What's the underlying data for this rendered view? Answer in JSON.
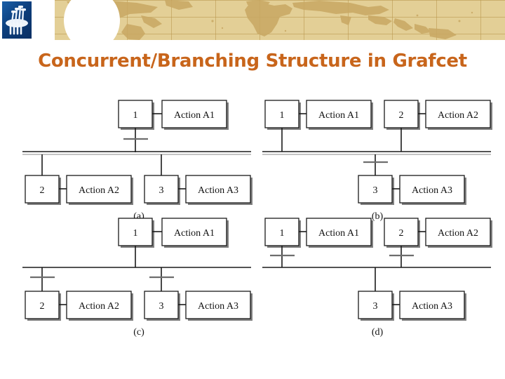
{
  "slide": {
    "title": "Concurrent/Branching Structure in Grafcet",
    "title_color": "#c8651b",
    "banner_color": "#e3cf96",
    "banner_grid_color": "#b7944a",
    "logo_color": "#0d3f7d",
    "background_color": "#ffffff"
  },
  "logo": {
    "name": "institution-logo",
    "description": "abstract white pipes over blue square"
  },
  "figure": {
    "name": "grafcet-branching-figure",
    "line_color": "#1a1a1a",
    "box_fill": "#ffffff",
    "diagrams": [
      {
        "id": "a",
        "caption": "(a)",
        "kind": "simultaneous-divergence",
        "rail": "double",
        "top_steps": [
          {
            "step": "1",
            "action": "Action A1"
          }
        ],
        "bottom_steps": [
          {
            "step": "2",
            "action": "Action A2"
          },
          {
            "step": "3",
            "action": "Action A3"
          }
        ],
        "transitions_above_rail": 1,
        "transitions_below_rail": 0
      },
      {
        "id": "b",
        "caption": "(b)",
        "kind": "simultaneous-convergence",
        "rail": "double",
        "top_steps": [
          {
            "step": "1",
            "action": "Action A1"
          },
          {
            "step": "2",
            "action": "Action A2"
          }
        ],
        "bottom_steps": [
          {
            "step": "3",
            "action": "Action A3"
          }
        ],
        "transitions_above_rail": 0,
        "transitions_below_rail": 1
      },
      {
        "id": "c",
        "caption": "(c)",
        "kind": "selective-divergence",
        "rail": "single",
        "top_steps": [
          {
            "step": "1",
            "action": "Action A1"
          }
        ],
        "bottom_steps": [
          {
            "step": "2",
            "action": "Action A2"
          },
          {
            "step": "3",
            "action": "Action A3"
          }
        ],
        "transitions_above_rail": 0,
        "transitions_below_rail": 2
      },
      {
        "id": "d",
        "caption": "(d)",
        "kind": "selective-convergence",
        "rail": "single",
        "top_steps": [
          {
            "step": "1",
            "action": "Action A1"
          },
          {
            "step": "2",
            "action": "Action A2"
          }
        ],
        "bottom_steps": [
          {
            "step": "3",
            "action": "Action A3"
          }
        ],
        "transitions_above_rail": 2,
        "transitions_below_rail": 0
      }
    ]
  }
}
